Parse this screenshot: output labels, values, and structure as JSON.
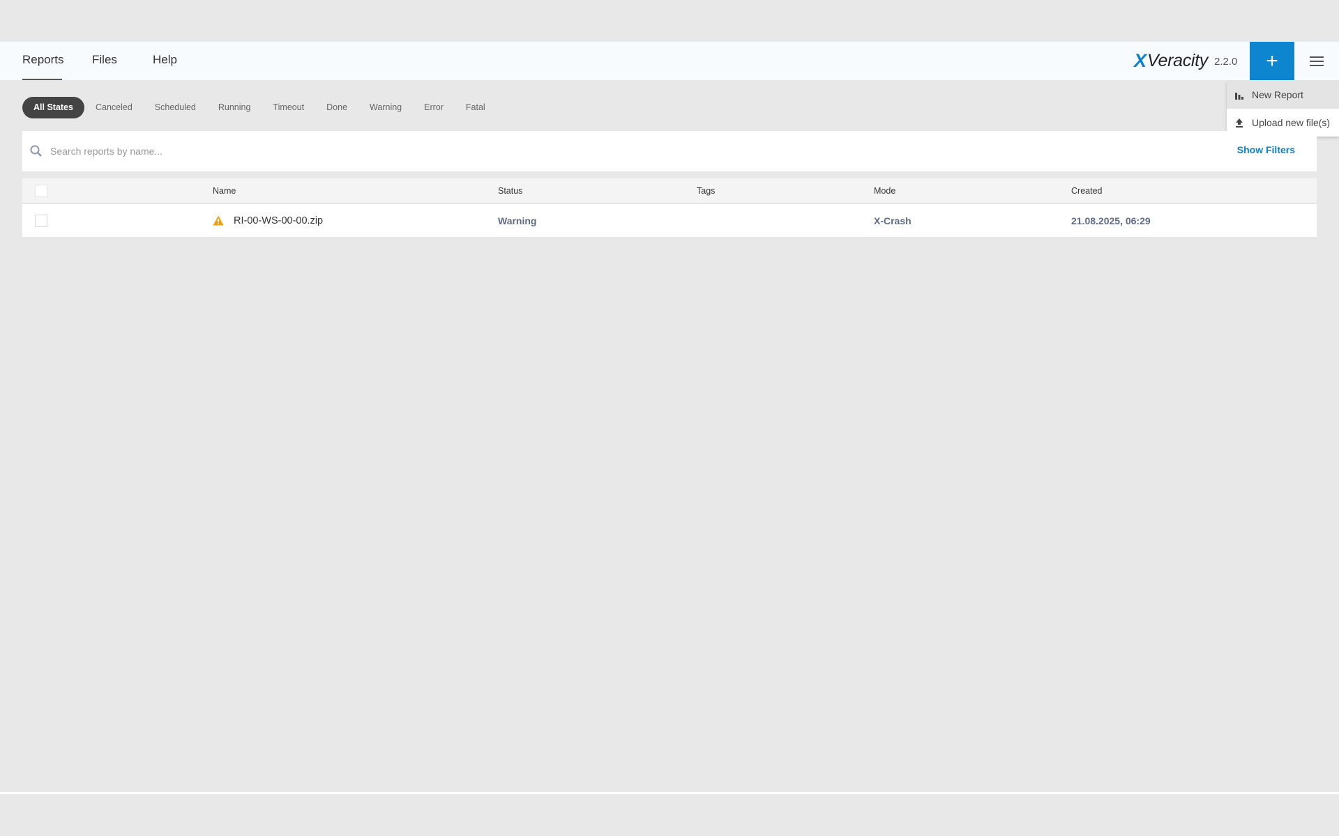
{
  "nav": {
    "tabs": [
      {
        "label": "Reports"
      },
      {
        "label": "Files"
      },
      {
        "label": "Help"
      }
    ],
    "brand_x": "X",
    "brand_name": "Veracity",
    "version": "2.2.0",
    "add_label": "+"
  },
  "dropdown": {
    "items": [
      {
        "label": "New Report",
        "icon": "bar-chart-icon"
      },
      {
        "label": "Upload new file(s)",
        "icon": "upload-icon"
      }
    ]
  },
  "states": [
    "All States",
    "Canceled",
    "Scheduled",
    "Running",
    "Timeout",
    "Done",
    "Warning",
    "Error",
    "Fatal"
  ],
  "search": {
    "placeholder": "Search reports by name...",
    "show_filters": "Show Filters"
  },
  "table": {
    "headers": {
      "name": "Name",
      "status": "Status",
      "tags": "Tags",
      "mode": "Mode",
      "created": "Created"
    },
    "rows": [
      {
        "name": "RI-00-WS-00-00.zip",
        "status": "Warning",
        "tags": "",
        "mode": "X-Crash",
        "created": "21.08.2025, 06:29",
        "icon": "warning-icon"
      }
    ]
  },
  "colors": {
    "accent": "#0d85cf",
    "warning": "#f29d0b",
    "status_text": "#5d6b8a"
  }
}
